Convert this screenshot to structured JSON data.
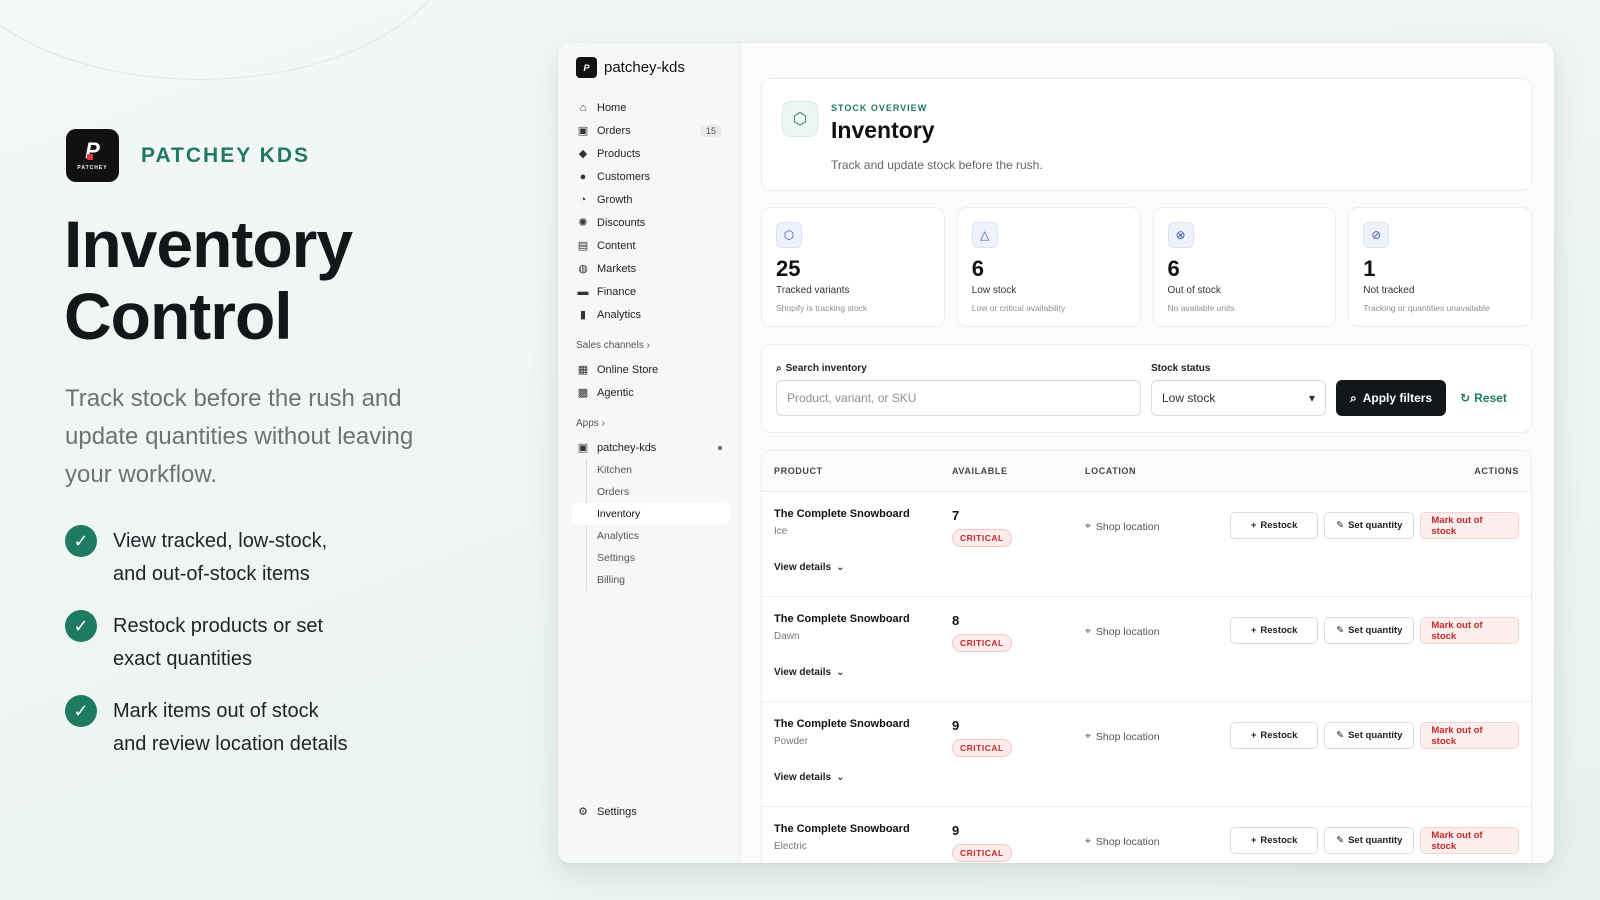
{
  "marketing": {
    "brand_mark": "P",
    "brand_word": "PATCHEY",
    "brand_name": "PATCHEY KDS",
    "title_line1": "Inventory",
    "title_line2": "Control",
    "subtitle": "Track stock before the rush and update quantities without leaving your workflow.",
    "features": [
      {
        "line1": "View tracked, low-stock,",
        "line2": "and out-of-stock items"
      },
      {
        "line1": "Restock products or set",
        "line2": "exact quantities"
      },
      {
        "line1": "Mark items out of stock",
        "line2": "and review location details"
      }
    ],
    "accent_color": "#1f7a63"
  },
  "sidebar": {
    "store_name": "patchey-kds",
    "items": [
      {
        "label": "Home",
        "icon": "home-icon"
      },
      {
        "label": "Orders",
        "icon": "inbox-icon",
        "count": "15"
      },
      {
        "label": "Products",
        "icon": "tag-icon"
      },
      {
        "label": "Customers",
        "icon": "person-icon"
      },
      {
        "label": "Growth",
        "icon": "gauge-icon"
      },
      {
        "label": "Discounts",
        "icon": "gear-badge-icon"
      },
      {
        "label": "Content",
        "icon": "content-icon"
      },
      {
        "label": "Markets",
        "icon": "globe-icon"
      },
      {
        "label": "Finance",
        "icon": "bank-icon"
      },
      {
        "label": "Analytics",
        "icon": "bar-chart-icon"
      }
    ],
    "sales_channels_label": "Sales channels",
    "channels": [
      {
        "label": "Online Store",
        "icon": "store-icon"
      },
      {
        "label": "Agentic",
        "icon": "agent-icon"
      }
    ],
    "apps_label": "Apps",
    "app_name": "patchey-kds",
    "app_sub_items": [
      "Kitchen",
      "Orders",
      "Inventory",
      "Analytics",
      "Settings",
      "Billing"
    ],
    "settings_label": "Settings"
  },
  "header": {
    "eyebrow": "STOCK OVERVIEW",
    "title": "Inventory",
    "description": "Track and update stock before the rush."
  },
  "stats": [
    {
      "value": "25",
      "label": "Tracked variants",
      "sub": "Shopify is tracking stock",
      "icon": "box-icon"
    },
    {
      "value": "6",
      "label": "Low stock",
      "sub": "Low or critical availability",
      "icon": "warning-icon"
    },
    {
      "value": "6",
      "label": "Out of stock",
      "sub": "No available units",
      "icon": "x-circle-icon"
    },
    {
      "value": "1",
      "label": "Not tracked",
      "sub": "Tracking or quantities unavailable",
      "icon": "no-track-icon"
    }
  ],
  "filters": {
    "search_label": "Search inventory",
    "search_placeholder": "Product, variant, or SKU",
    "status_label": "Stock status",
    "status_value": "Low stock",
    "apply_label": "Apply filters",
    "reset_label": "Reset"
  },
  "table": {
    "headers": {
      "product": "PRODUCT",
      "available": "AVAILABLE",
      "location": "LOCATION",
      "actions": "ACTIONS"
    },
    "restock_label": "Restock",
    "set_quantity_label": "Set quantity",
    "mark_out_label": "Mark out of stock",
    "view_details_label": "View details",
    "rows": [
      {
        "name": "The Complete Snowboard",
        "variant": "Ice",
        "available": "7",
        "status": "CRITICAL",
        "location": "Shop location"
      },
      {
        "name": "The Complete Snowboard",
        "variant": "Dawn",
        "available": "8",
        "status": "CRITICAL",
        "location": "Shop location"
      },
      {
        "name": "The Complete Snowboard",
        "variant": "Powder",
        "available": "9",
        "status": "CRITICAL",
        "location": "Shop location"
      },
      {
        "name": "The Complete Snowboard",
        "variant": "Electric",
        "available": "9",
        "status": "CRITICAL",
        "location": "Shop location"
      }
    ]
  }
}
